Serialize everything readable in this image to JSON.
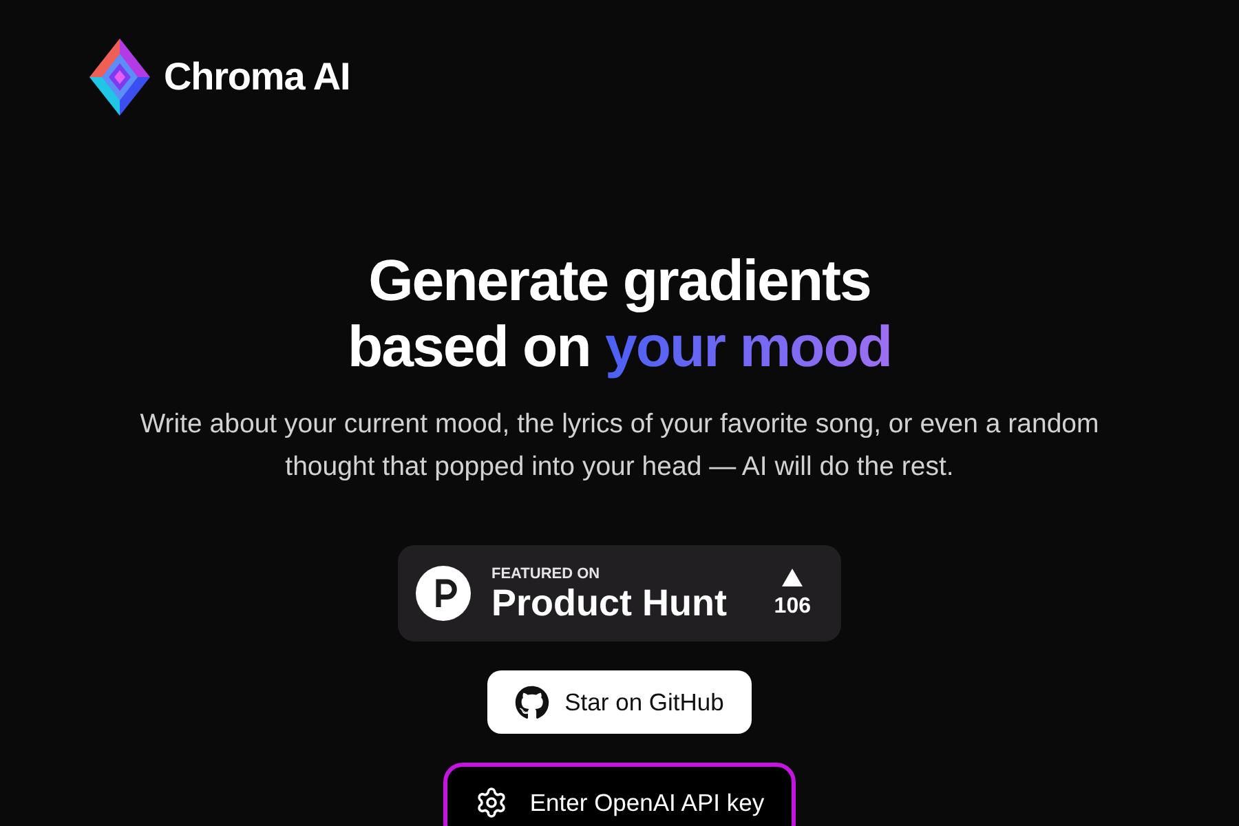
{
  "header": {
    "brand": "Chroma AI"
  },
  "hero": {
    "headline": {
      "line_1": "Generate gradients",
      "line_2": "based on",
      "highlight": "your mood"
    },
    "description": "Write about your current mood, the lyrics of your favorite song, or even a random thought that popped into your head — AI will do the rest."
  },
  "product_hunt_badge": {
    "eyebrow": "FEATURED ON",
    "name": "Product Hunt",
    "upvotes": "106"
  },
  "buttons": [
    {
      "kind": "github",
      "label": "Star on GitHub"
    },
    {
      "kind": "apikey",
      "label": "Enter OpenAI API key"
    }
  ]
}
